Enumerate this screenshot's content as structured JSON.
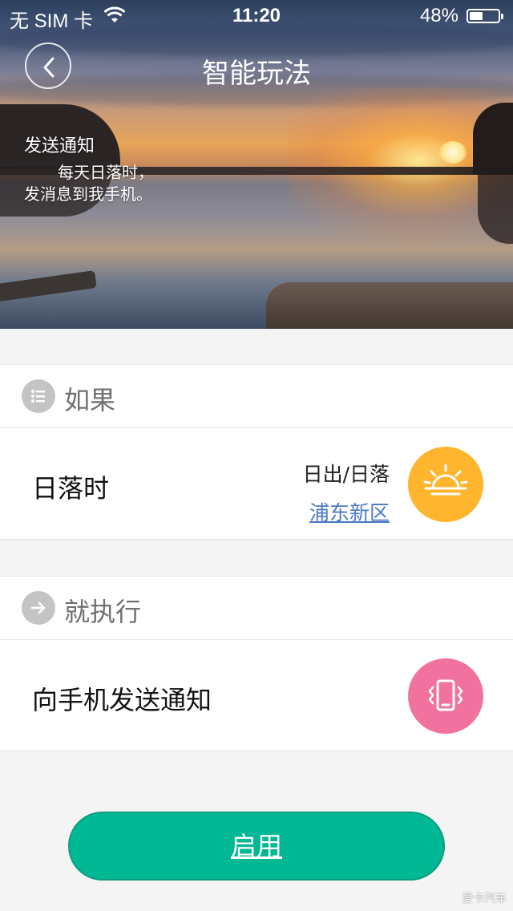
{
  "status_bar": {
    "carrier": "无 SIM 卡",
    "time": "11:20",
    "battery_percent": "48%",
    "battery_level": 0.48
  },
  "nav": {
    "title": "智能玩法",
    "back_icon": "chevron-left-icon"
  },
  "hero": {
    "subtitle": "发送通知",
    "description_line1": "每天日落时，",
    "description_line2": "发消息到我手机。"
  },
  "if_section": {
    "label": "如果",
    "icon": "list-icon",
    "condition": {
      "title": "日落时",
      "type": "日出/日落",
      "location": "浦东新区",
      "icon": "sunset-icon",
      "icon_color": "#ffb52e"
    }
  },
  "then_section": {
    "label": "就执行",
    "icon": "arrow-right-icon",
    "action": {
      "title": "向手机发送通知",
      "icon": "phone-vibrate-icon",
      "icon_color": "#f2729f"
    }
  },
  "enable_button": {
    "label": "启用",
    "color": "#00b894"
  },
  "watermark": "爱卡汽车"
}
